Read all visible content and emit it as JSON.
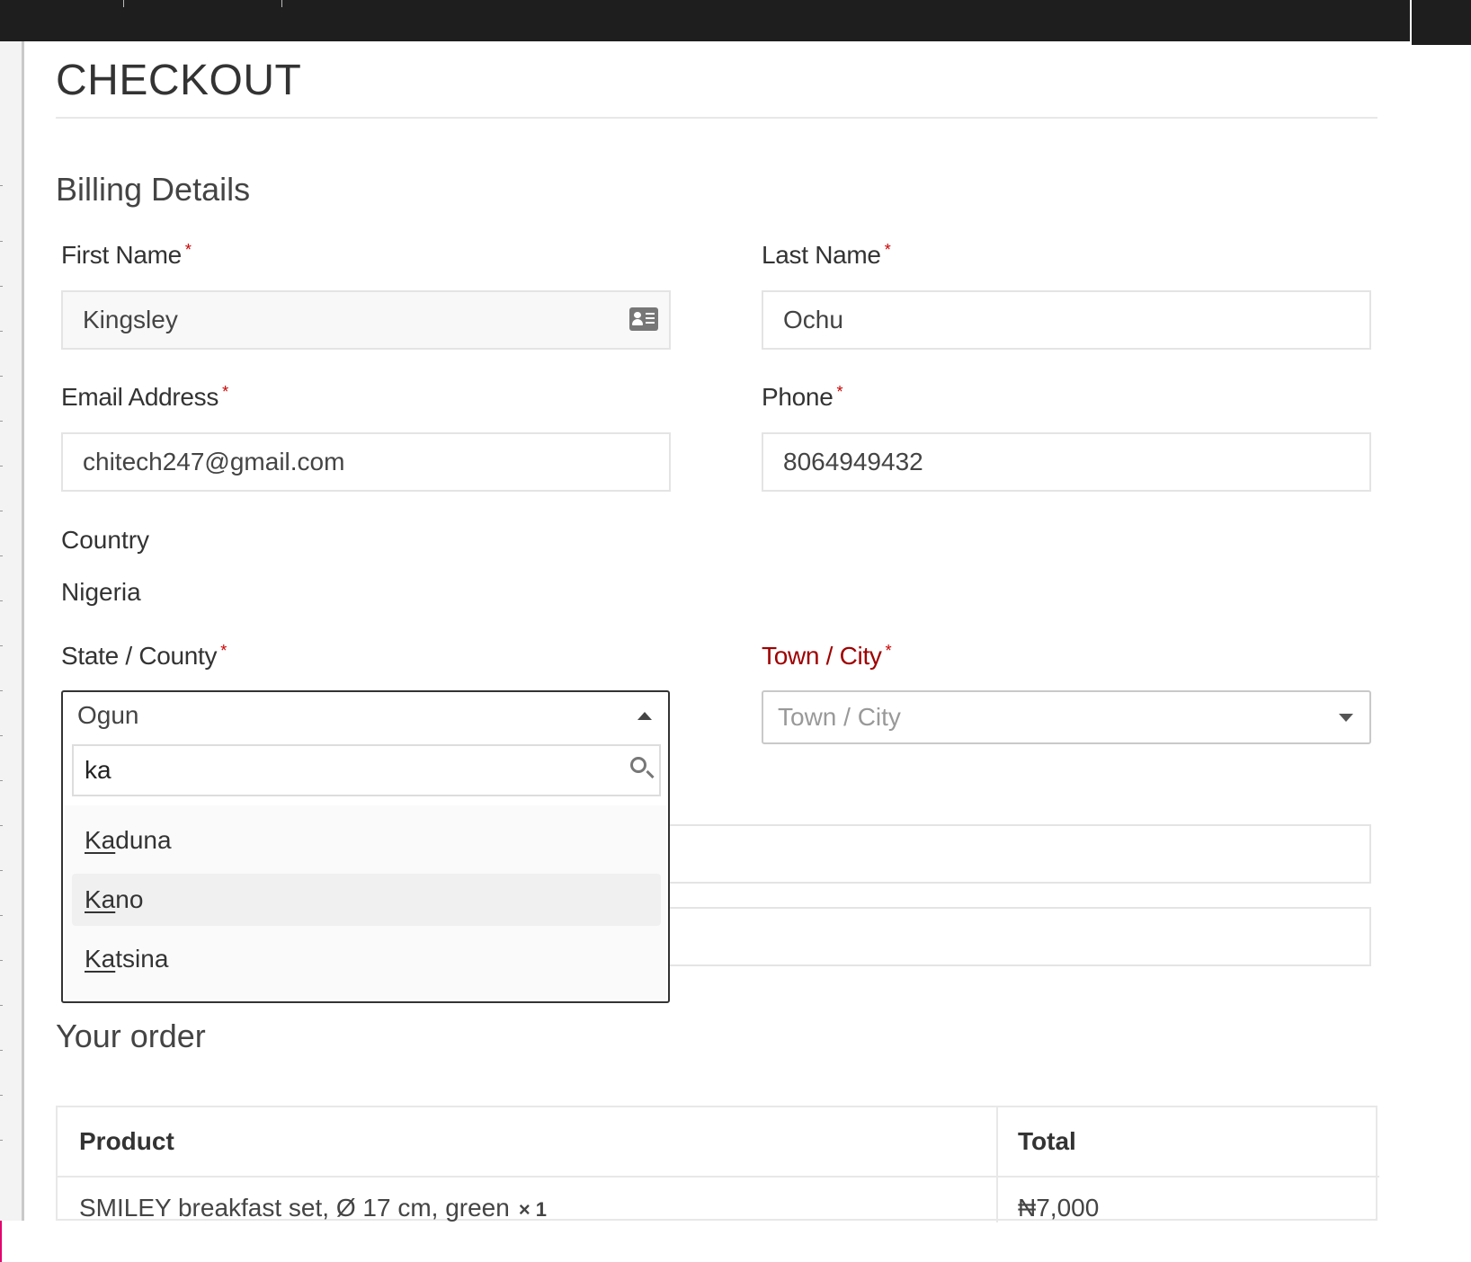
{
  "page": {
    "title": "CHECKOUT"
  },
  "billing": {
    "heading": "Billing Details",
    "first_name": {
      "label": "First Name",
      "value": "Kingsley"
    },
    "last_name": {
      "label": "Last Name",
      "value": "Ochu"
    },
    "email": {
      "label": "Email Address",
      "value": "chitech247@gmail.com"
    },
    "phone": {
      "label": "Phone",
      "value": "8064949432"
    },
    "country": {
      "label": "Country",
      "value": "Nigeria"
    },
    "state": {
      "label": "State / County",
      "selected": "Ogun",
      "search_value": "ka",
      "options": [
        {
          "match": "Ka",
          "rest": "duna"
        },
        {
          "match": "Ka",
          "rest": "no"
        },
        {
          "match": "Ka",
          "rest": "tsina"
        }
      ]
    },
    "town": {
      "label": "Town / City",
      "placeholder": "Town / City"
    },
    "required_mark": "*"
  },
  "order": {
    "heading": "Your order",
    "columns": [
      "Product",
      "Total"
    ],
    "rows": [
      {
        "product": "SMILEY breakfast set, Ø 17 cm, green",
        "qty": "× 1",
        "total": "₦7,000"
      }
    ]
  },
  "icons": [
    "contact-card-icon",
    "caret-up-icon",
    "caret-down-icon",
    "search-icon"
  ]
}
